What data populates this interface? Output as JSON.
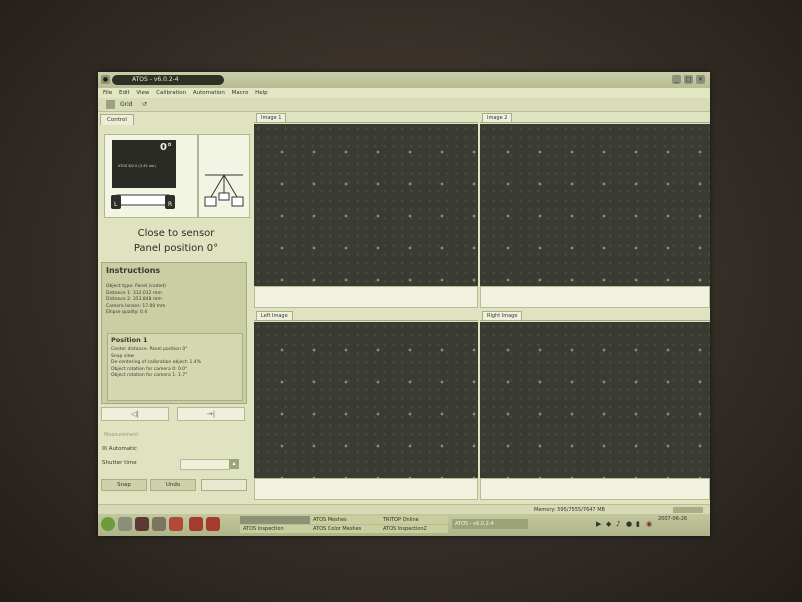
{
  "app": {
    "title": "ATOS - v6.0.2-4"
  },
  "menu": [
    "File",
    "Edit",
    "View",
    "Calibration",
    "Automation",
    "Macro",
    "Help"
  ],
  "toolbar": {
    "grid": "Grid"
  },
  "left_panel": {
    "tab_label": "Control",
    "sensor_angle": "0°",
    "monitor_text": "ATOS 6/2.0 (3.45 um)",
    "status_line1": "Close to sensor",
    "status_line2": "Panel position 0°",
    "instructions": {
      "title": "Instructions",
      "lines": [
        "Object type: Panel (coded)",
        "Distance 1: 312.012 mm",
        "Distance 2: 353.848 mm",
        "Camera lenses: 17.00 mm",
        "Ellipse quality: 0.4"
      ]
    },
    "position": {
      "title": "Position 1",
      "lines": [
        "Center distance. Panel position 0°",
        "Snap view",
        "De-centering of calibration object: 1.4%",
        "Object rotation for camera 0: 0.0°",
        "Object rotation for camera 1: 1.7°"
      ]
    },
    "measure_label": "Measurement",
    "automatic_label": "Automatic",
    "shutter_label": "Shutter time",
    "buttons": {
      "snap": "Snap",
      "undo": "Undo"
    }
  },
  "views": {
    "top_left": "Image 1",
    "top_right": "Image 2",
    "bottom_left": "Left Image",
    "bottom_right": "Right Image"
  },
  "status": {
    "memory": "Memory: 595/7555/7647 MB"
  },
  "taskbar": {
    "tasks_top": [
      "ATOS Meshes",
      "TRITOP Online"
    ],
    "tasks_bottom": [
      "ATOS Inspection",
      "ATOS Color Meshes",
      "ATOS Inspection2"
    ],
    "active_task": "ATOS - v6.0.2-4",
    "date": "2007-06-26"
  }
}
